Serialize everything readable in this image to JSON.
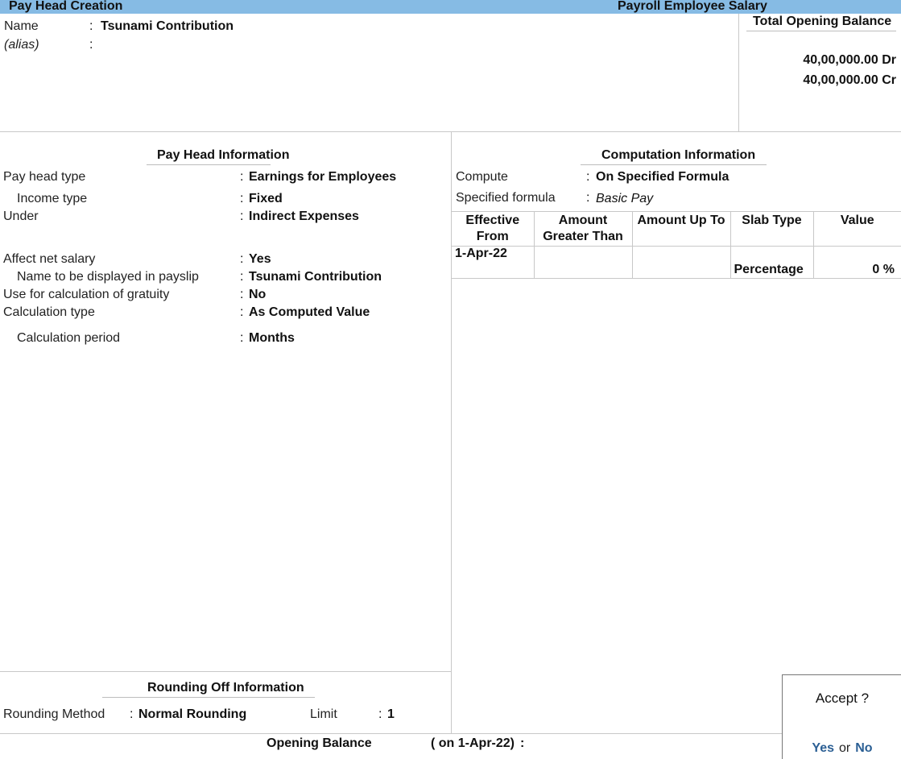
{
  "titlebar": {
    "left_title": "Pay Head  Creation",
    "center_title": "Payroll Employee Salary"
  },
  "header": {
    "name_label": "Name",
    "name_value": "Tsunami Contribution",
    "alias_label": "(alias)",
    "alias_value": "",
    "separator": ":"
  },
  "total_opening_balance": {
    "title": "Total Opening Balance",
    "debit": "40,00,000.00 Dr",
    "credit": "40,00,000.00 Cr"
  },
  "pay_head_info": {
    "title": "Pay Head Information",
    "fields": [
      {
        "label": "Pay head type",
        "value": "Earnings for Employees"
      },
      {
        "label": "Income type",
        "value": "Fixed"
      },
      {
        "label": "Under",
        "value": "Indirect Expenses"
      },
      {
        "label": "Affect net salary",
        "value": "Yes"
      },
      {
        "label": "Name to be displayed in payslip",
        "value": "Tsunami Contribution"
      },
      {
        "label": "Use for calculation of gratuity",
        "value": "No"
      },
      {
        "label": "Calculation type",
        "value": "As Computed Value"
      },
      {
        "label": "Calculation period",
        "value": "Months"
      }
    ]
  },
  "computation_info": {
    "title": "Computation Information",
    "compute_label": "Compute",
    "compute_value": "On Specified Formula",
    "formula_label": "Specified formula",
    "formula_value": "Basic Pay",
    "table": {
      "headers": [
        "Effective From",
        "Amount Greater Than",
        "Amount Up To",
        "Slab Type",
        "Value"
      ],
      "header_lines": [
        [
          "Effective",
          "From"
        ],
        [
          "Amount",
          "Greater Than"
        ],
        [
          "Amount Up To"
        ],
        [
          "Slab Type"
        ],
        [
          "Value"
        ]
      ],
      "rows": [
        {
          "effective_from": "1-Apr-22",
          "amount_greater_than": "",
          "amount_up_to": "",
          "slab_type": "Percentage",
          "value": "0 %"
        }
      ]
    }
  },
  "rounding_info": {
    "title": "Rounding Off Information",
    "method_label": "Rounding Method",
    "method_value": "Normal Rounding",
    "limit_label": "Limit",
    "limit_value": "1"
  },
  "opening_balance": {
    "label": "Opening Balance",
    "date_label": "( on 1-Apr-22)",
    "separator": ":",
    "value": ""
  },
  "accept_dialog": {
    "question": "Accept ?",
    "yes_label": "Yes",
    "or_label": "or",
    "no_label": "No"
  }
}
